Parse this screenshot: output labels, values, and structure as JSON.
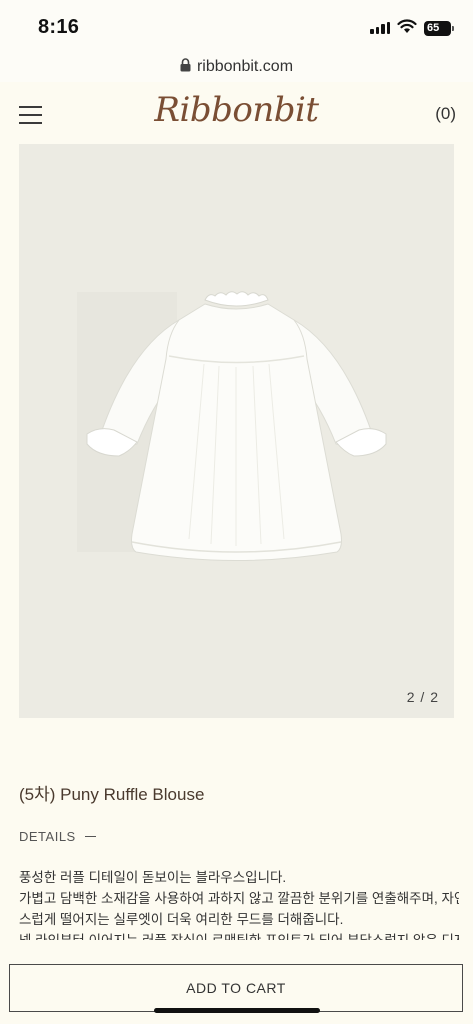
{
  "status_bar": {
    "time": "8:16",
    "battery": "65",
    "icons": [
      "signal-icon",
      "wifi-icon",
      "battery-icon"
    ]
  },
  "browser": {
    "url": "ribbonbit.com",
    "icons": [
      "lock-icon"
    ]
  },
  "header": {
    "logo": "Ribbonbit",
    "cart_count": "(0)",
    "icons": [
      "menu-icon"
    ]
  },
  "product": {
    "image_counter": "2 / 2",
    "title": "(5차) Puny Ruffle Blouse",
    "details_label": "DETAILS",
    "description": [
      "풍성한 러플 디테일이 돋보이는 블라우스입니다.",
      "가볍고 담백한 소재감을 사용하여 과하지 않고 깔끔한 분위기를 연출해주며, 자연",
      "스럽게 떨어지는 실루엣이 더욱 여리한 무드를 더해줍니다.",
      "넥 라인부터 이어지는 러플 장식이 로맨틱한 포인트가 되어 부담스럽지 않은 디자"
    ]
  },
  "actions": {
    "add_to_cart": "ADD TO CART"
  },
  "colors": {
    "background": "#fdfbf1",
    "logo": "#7a4e34",
    "image_bg": "#ecebe3"
  }
}
